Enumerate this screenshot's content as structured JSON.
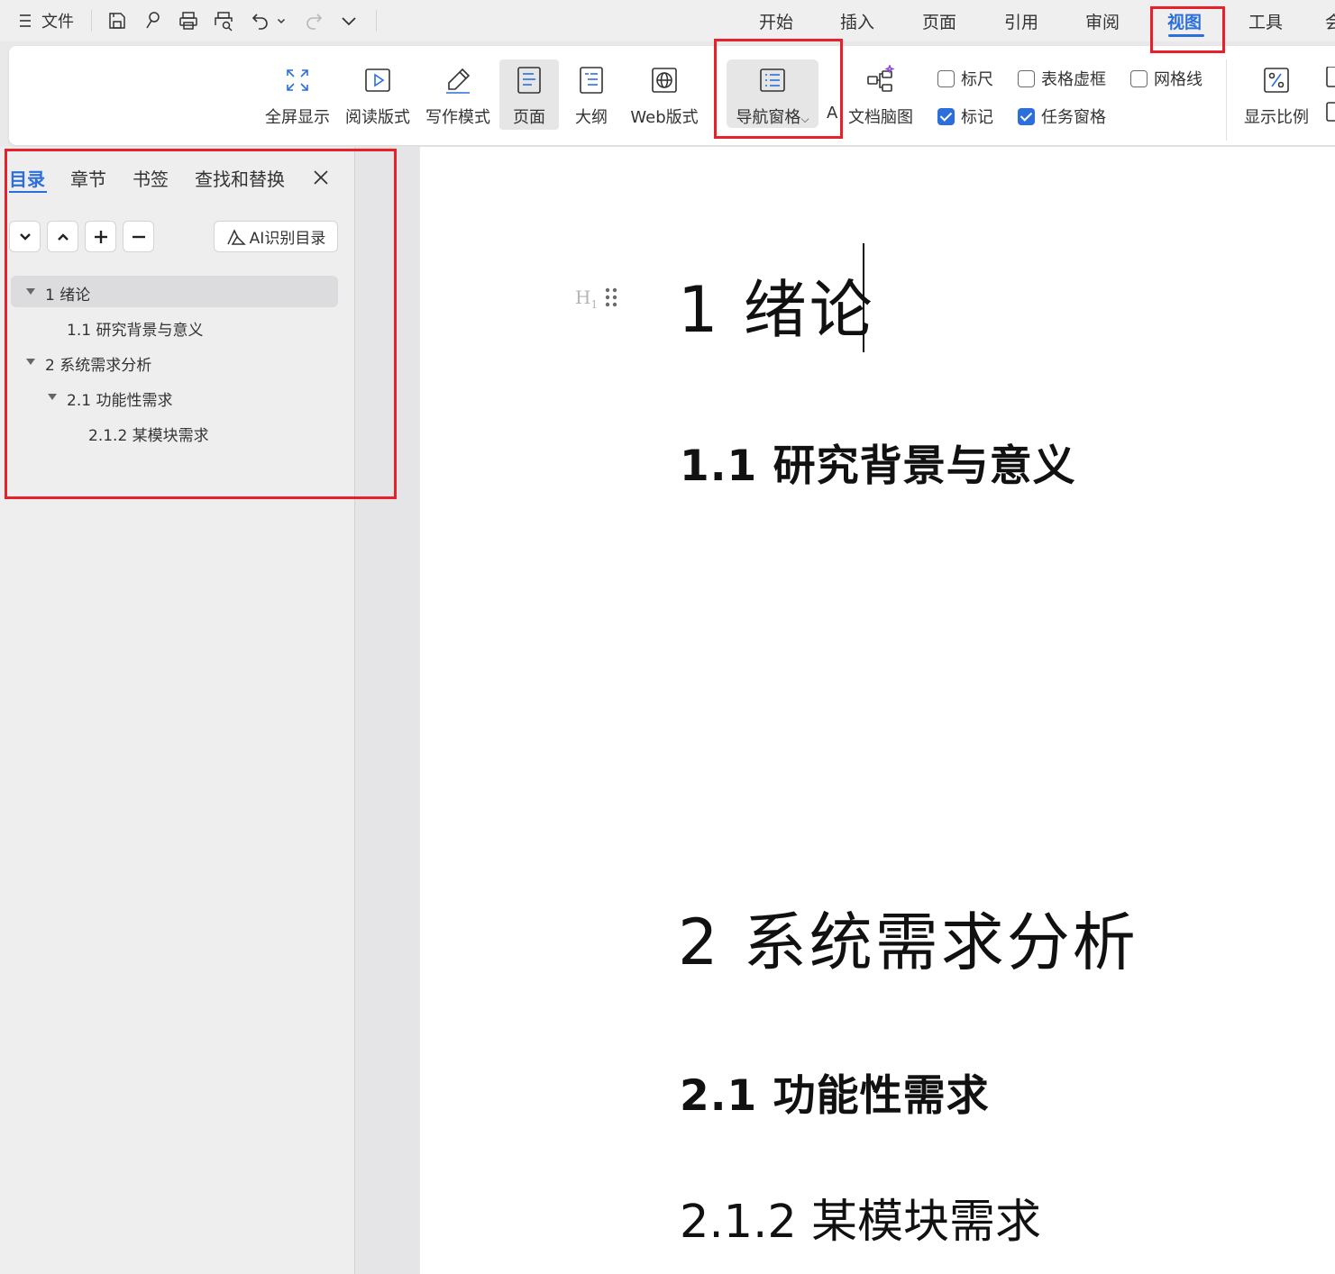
{
  "topbar": {
    "file_label": "文件",
    "menu_tabs": [
      "开始",
      "插入",
      "页面",
      "引用",
      "审阅",
      "视图",
      "工具",
      "会"
    ],
    "active_tab": "视图"
  },
  "ribbon": {
    "buttons": {
      "fullscreen": "全屏显示",
      "reading": "阅读版式",
      "writing": "写作模式",
      "page": "页面",
      "outline": "大纲",
      "web": "Web版式",
      "nav_pane": "导航窗格",
      "partial_a": "A",
      "mindmap": "文档脑图",
      "zoom": "显示比例"
    },
    "checkboxes": {
      "ruler": {
        "label": "标尺",
        "checked": false
      },
      "table_gridlines": {
        "label": "表格虚框",
        "checked": false
      },
      "gridlines": {
        "label": "网格线",
        "checked": false
      },
      "markup": {
        "label": "标记",
        "checked": true
      },
      "task_pane": {
        "label": "任务窗格",
        "checked": true
      }
    }
  },
  "nav_pane": {
    "tabs": [
      "目录",
      "章节",
      "书签",
      "查找和替换"
    ],
    "active_tab": "目录",
    "ai_button": "AI识别目录",
    "toc": [
      {
        "text": "1  绪论",
        "level": 1,
        "expanded": true,
        "selected": true
      },
      {
        "text": "1.1  研究背景与意义",
        "level": 2
      },
      {
        "text": "2  系统需求分析",
        "level": 1,
        "expanded": true
      },
      {
        "text": "2.1  功能性需求",
        "level": 2,
        "expanded": true
      },
      {
        "text": "2.1.2  某模块需求",
        "level": 3
      }
    ]
  },
  "document": {
    "heading_tag": "H",
    "heading_tag_sub": "1",
    "h1_a": "1  绪论",
    "h2_a": "1.1  研究背景与意义",
    "h1_b": "2  系统需求分析",
    "h2_b": "2.1  功能性需求",
    "h3_a": "2.1.2  某模块需求"
  },
  "colors": {
    "accent": "#2c6fdc",
    "annotation_red": "#e8202a"
  }
}
